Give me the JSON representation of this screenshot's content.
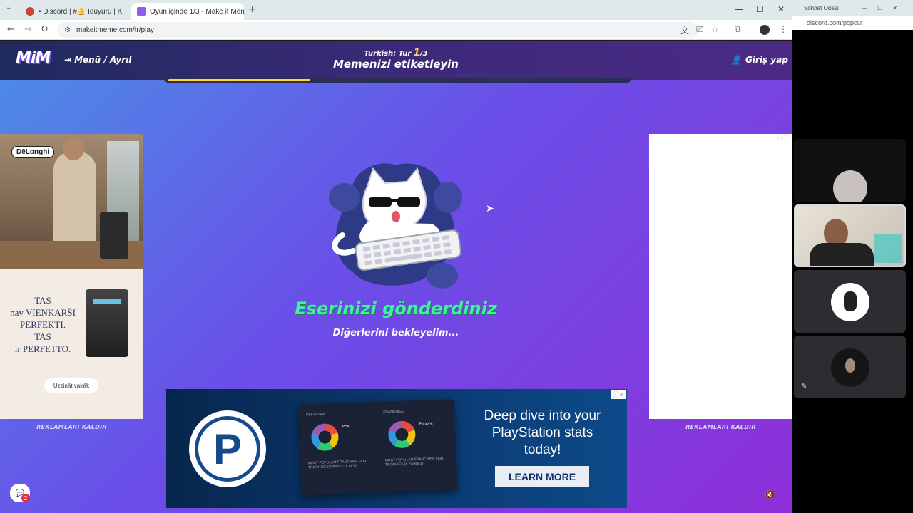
{
  "browser": {
    "tabs": [
      {
        "label": "• Discord | #🔔 Iduyuru | K",
        "active": false
      },
      {
        "label": "Oyun içinde 1/3 - Make it Mem",
        "active": true
      }
    ],
    "new_tab": "+",
    "url": "makeitmeme.com/tr/play",
    "window_controls": {
      "minimize": "—",
      "maximize": "☐",
      "close": "✕"
    }
  },
  "site": {
    "logo": "MiM",
    "menu_label": "Menü / Ayrıl",
    "round_prefix": "Turkish: Tur ",
    "round_current": "1",
    "round_total": "/3",
    "header_title": "Memenizi etiketleyin",
    "login_label": "Giriş yap",
    "progress": 0.31,
    "ghost_text": "alev alev"
  },
  "main": {
    "status_title": "Eserinizi gönderdiniz",
    "status_subtitle": "Diğerlerini bekleyelim..."
  },
  "ads": {
    "left_brand": "DēLonghi",
    "left_lines": [
      "TAS",
      "nav VIENKĀRŠI",
      "PERFEKTI.",
      "TAS",
      "ir PERFETTO."
    ],
    "left_button": "Uzzināt vairāk",
    "remove_ads": "REKLAMLARI KALDIR",
    "bottom_headline": "Deep dive into your PlayStation stats today!",
    "bottom_cta": "LEARN MORE",
    "bottom_logo_letter": "P",
    "card_left_title": "PLATFORM",
    "card_right_title": "FRANCHISE",
    "card_left_caption": "MOST POPULAR FRANCHISE FOR TROPHIES (COMPLETION %)",
    "card_right_caption": "MOST POPULAR FRANCHISE FOR TROPHIES (# EARNED)",
    "card_left_platform": "PS4",
    "card_right_platform": "Persona"
  },
  "chat_badge": "2",
  "discord": {
    "title": "Sohbet Odası",
    "url": "discord.com/popout"
  },
  "colors": {
    "accent_green": "#3ff2a0",
    "progress_yellow": "#ffd633",
    "header_bg": "#2a2d66"
  }
}
